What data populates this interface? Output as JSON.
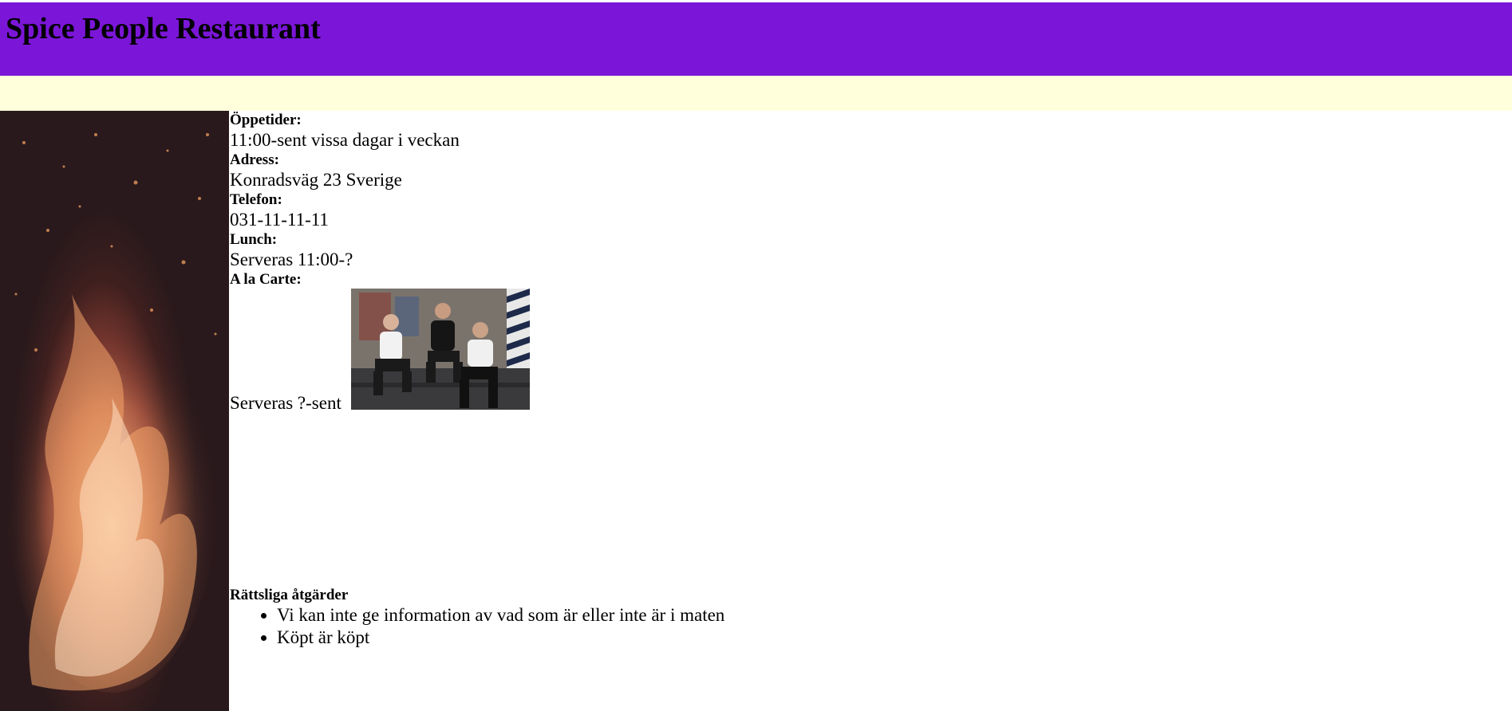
{
  "header": {
    "title": "Spice People Restaurant",
    "background_color": "#7b16d8"
  },
  "nav": {
    "background_color": "#ffffdc"
  },
  "info": {
    "hours_label": "Öppetider:",
    "hours_value": "11:00-sent vissa dagar i veckan",
    "address_label": "Adress:",
    "address_value": "Konradsväg 23 Sverige",
    "phone_label": "Telefon:",
    "phone_value": "031-11-11-11",
    "lunch_label": "Lunch:",
    "lunch_value": "Serveras 11:00-?",
    "alacarte_label": "A la Carte:",
    "alacarte_value": "Serveras ?-sent"
  },
  "images": {
    "side": "fire-flames-photo",
    "chefs": "three-chefs-sitting-photo"
  },
  "legal": {
    "heading": "Rättsliga åtgärder",
    "items": [
      "Vi kan inte ge information av vad som är eller inte är i maten",
      "Köpt är köpt"
    ]
  }
}
